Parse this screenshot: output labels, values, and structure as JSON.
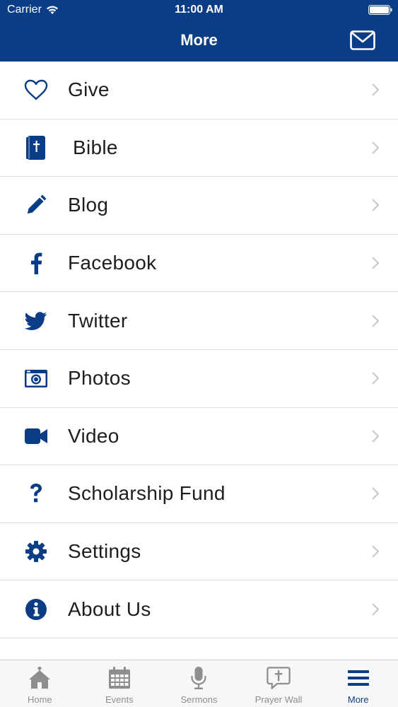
{
  "status_bar": {
    "carrier": "Carrier",
    "time": "11:00 AM"
  },
  "nav": {
    "title": "More"
  },
  "menu": [
    {
      "label": "Give",
      "icon": "heart-icon"
    },
    {
      "label": "Bible",
      "icon": "bible-icon"
    },
    {
      "label": "Blog",
      "icon": "pencil-icon"
    },
    {
      "label": "Facebook",
      "icon": "facebook-icon"
    },
    {
      "label": "Twitter",
      "icon": "twitter-icon"
    },
    {
      "label": "Photos",
      "icon": "camera-icon"
    },
    {
      "label": "Video",
      "icon": "video-camera-icon"
    },
    {
      "label": "Scholarship Fund",
      "icon": "question-mark-icon"
    },
    {
      "label": "Settings",
      "icon": "gear-icon"
    },
    {
      "label": "About Us",
      "icon": "info-icon"
    }
  ],
  "tabs": [
    {
      "label": "Home",
      "icon": "house-icon",
      "active": false
    },
    {
      "label": "Events",
      "icon": "calendar-icon",
      "active": false
    },
    {
      "label": "Sermons",
      "icon": "microphone-icon",
      "active": false
    },
    {
      "label": "Prayer Wall",
      "icon": "speech-bubble-cross-icon",
      "active": false
    },
    {
      "label": "More",
      "icon": "hamburger-menu-icon",
      "active": true
    }
  ],
  "colors": {
    "brand": "#0a3d85",
    "tab_inactive": "#8e8e8e",
    "text": "#1e1e1e"
  }
}
